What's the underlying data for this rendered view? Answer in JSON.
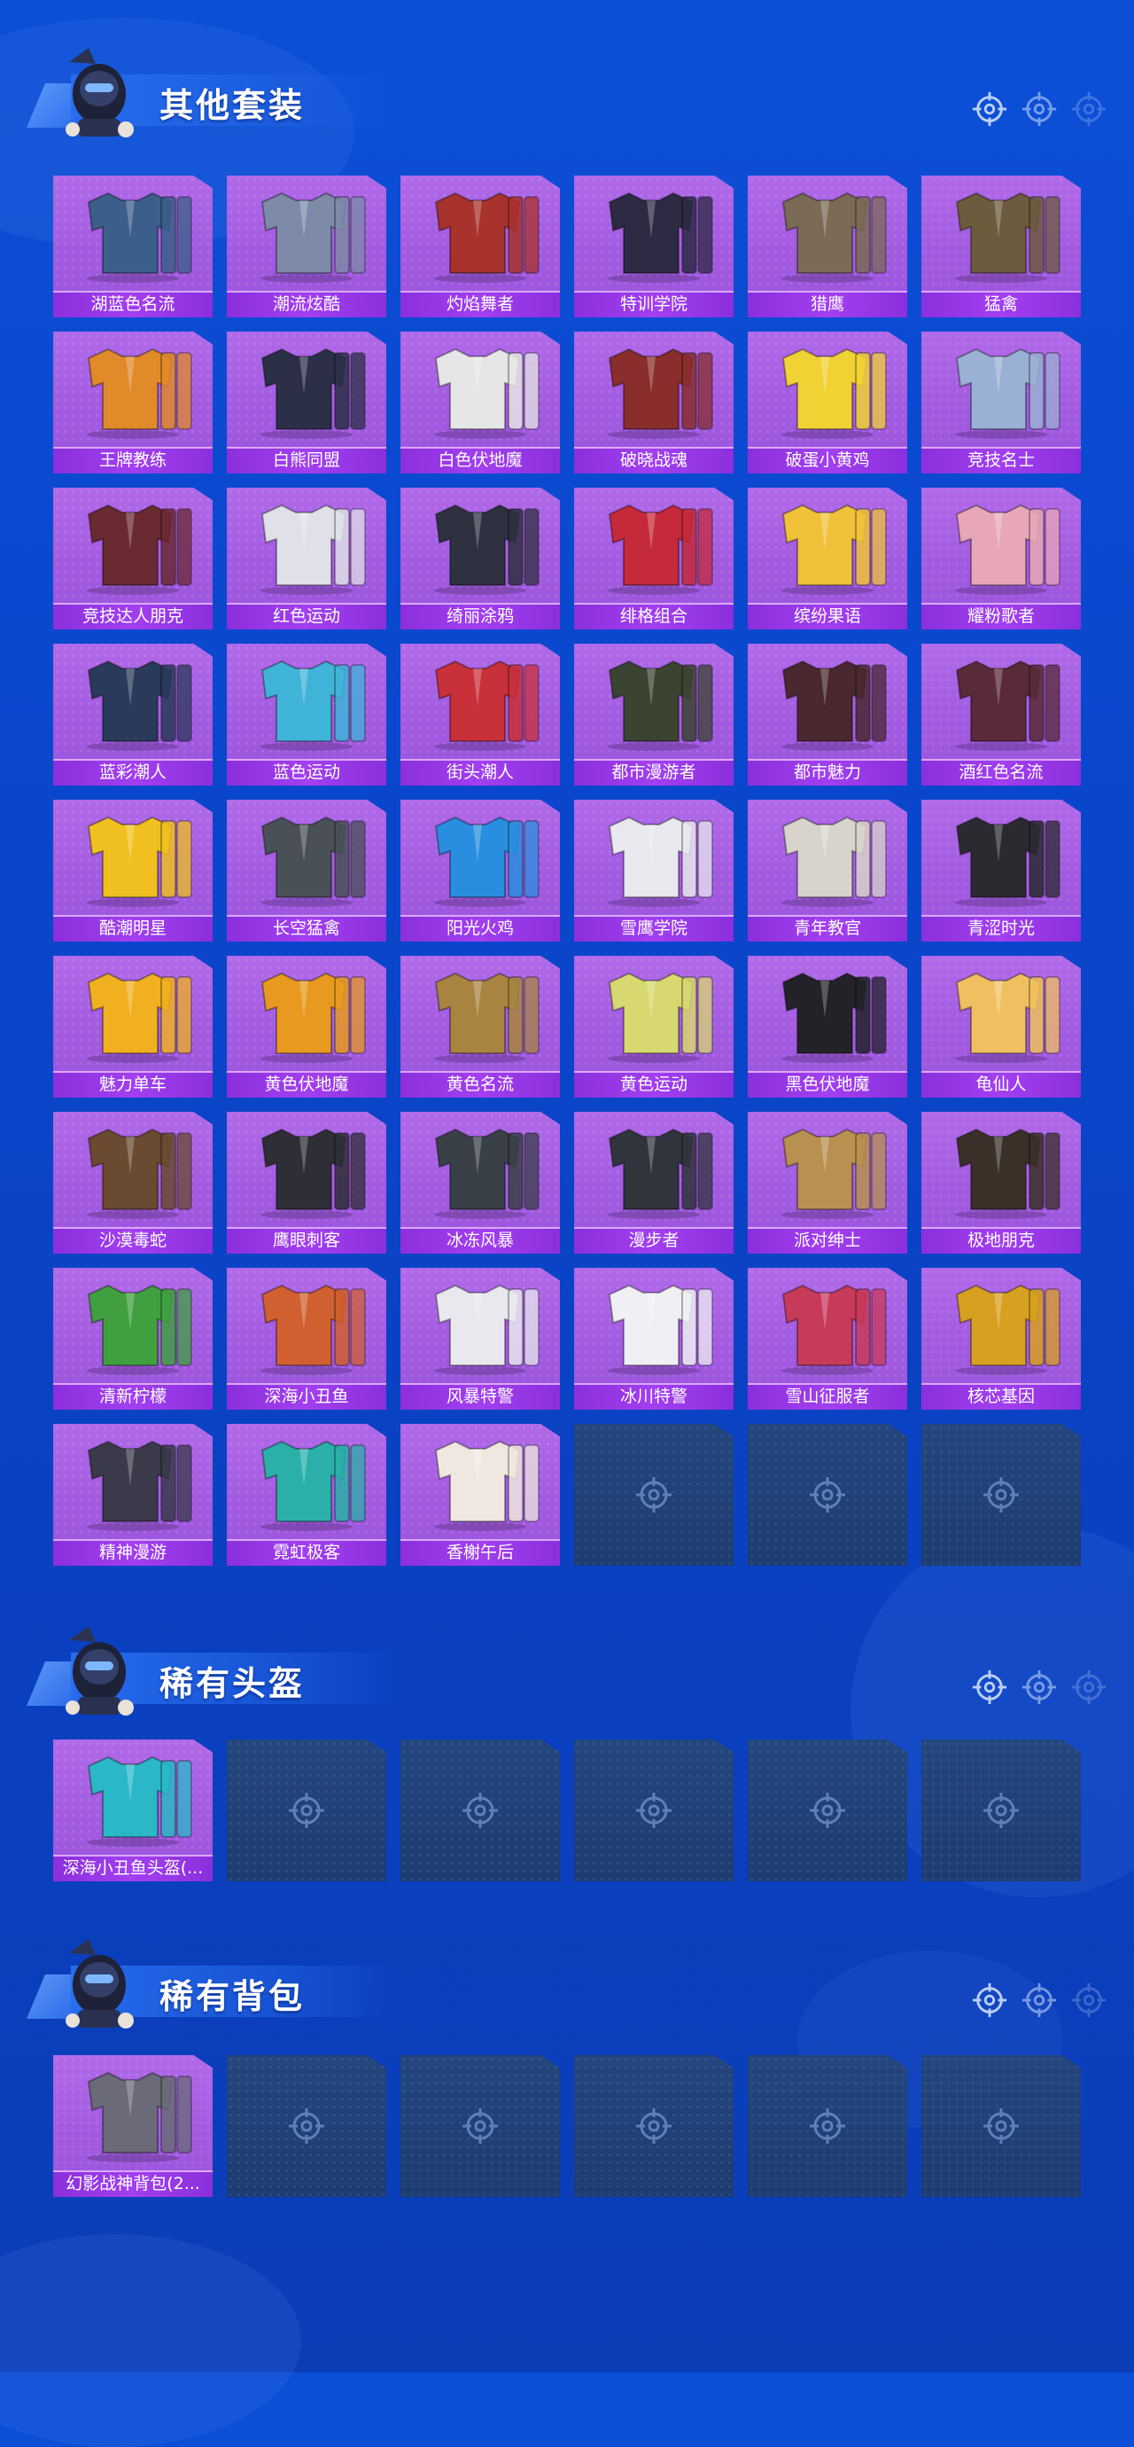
{
  "sections": [
    {
      "title": "其他套装",
      "items": [
        {
          "label": "湖蓝色名流",
          "color": "#3b5f8a"
        },
        {
          "label": "潮流炫酷",
          "color": "#7d8aa8"
        },
        {
          "label": "灼焰舞者",
          "color": "#a8322c"
        },
        {
          "label": "特训学院",
          "color": "#2d2a44"
        },
        {
          "label": "猎鹰",
          "color": "#7b6a55"
        },
        {
          "label": "猛禽",
          "color": "#6d5b3e"
        },
        {
          "label": "王牌教练",
          "color": "#e08a2a"
        },
        {
          "label": "白熊同盟",
          "color": "#2c2f48"
        },
        {
          "label": "白色伏地魔",
          "color": "#e6e6e6"
        },
        {
          "label": "破晓战魂",
          "color": "#8a2d2d"
        },
        {
          "label": "破蛋小黄鸡",
          "color": "#f1d234"
        },
        {
          "label": "竞技名士",
          "color": "#9ab0d4"
        },
        {
          "label": "竞技达人朋克",
          "color": "#6a2a32"
        },
        {
          "label": "红色运动",
          "color": "#e0e0e8"
        },
        {
          "label": "绮丽涂鸦",
          "color": "#2e3140"
        },
        {
          "label": "绯格组合",
          "color": "#c42a3a"
        },
        {
          "label": "缤纷果语",
          "color": "#f0c23a"
        },
        {
          "label": "耀粉歌者",
          "color": "#e8a7b8"
        },
        {
          "label": "蓝彩潮人",
          "color": "#2a3a5a"
        },
        {
          "label": "蓝色运动",
          "color": "#3fb4d8"
        },
        {
          "label": "街头潮人",
          "color": "#c8303a"
        },
        {
          "label": "都市漫游者",
          "color": "#3a4430"
        },
        {
          "label": "都市魅力",
          "color": "#4a2830"
        },
        {
          "label": "酒红色名流",
          "color": "#5a2a38"
        },
        {
          "label": "酷潮明星",
          "color": "#f0c020"
        },
        {
          "label": "长空猛禽",
          "color": "#4a5058"
        },
        {
          "label": "阳光火鸡",
          "color": "#2a8ee0"
        },
        {
          "label": "雪鹰学院",
          "color": "#e8e8ee"
        },
        {
          "label": "青年教官",
          "color": "#d8d4cc"
        },
        {
          "label": "青涩时光",
          "color": "#2a2a30"
        },
        {
          "label": "魅力单车",
          "color": "#f0b020"
        },
        {
          "label": "黄色伏地魔",
          "color": "#e89a20"
        },
        {
          "label": "黄色名流",
          "color": "#a88440"
        },
        {
          "label": "黄色运动",
          "color": "#d8d870"
        },
        {
          "label": "黑色伏地魔",
          "color": "#222228"
        },
        {
          "label": "龟仙人",
          "color": "#f0c060"
        },
        {
          "label": "沙漠毒蛇",
          "color": "#6a4a30"
        },
        {
          "label": "鹰眼刺客",
          "color": "#2e2e36"
        },
        {
          "label": "冰冻风暴",
          "color": "#3a4048"
        },
        {
          "label": "漫步者",
          "color": "#30343c"
        },
        {
          "label": "派对绅士",
          "color": "#b89050"
        },
        {
          "label": "极地朋克",
          "color": "#3a3028"
        },
        {
          "label": "清新柠檬",
          "color": "#40a040"
        },
        {
          "label": "深海小丑鱼",
          "color": "#d06030"
        },
        {
          "label": "风暴特警",
          "color": "#e8e8ee"
        },
        {
          "label": "冰川特警",
          "color": "#f0f0f4"
        },
        {
          "label": "雪山征服者",
          "color": "#c83a5a"
        },
        {
          "label": "核芯基因",
          "color": "#d8a020"
        },
        {
          "label": "精神漫游",
          "color": "#3a3a4a"
        },
        {
          "label": "霓虹极客",
          "color": "#2ab0a8"
        },
        {
          "label": "香榭午后",
          "color": "#f0e8e0"
        }
      ],
      "empty_slots": 3
    },
    {
      "title": "稀有头盔",
      "items": [
        {
          "label": "深海小丑鱼头盔(...",
          "color": "#2ab8c8"
        }
      ],
      "empty_slots": 5
    },
    {
      "title": "稀有背包",
      "items": [
        {
          "label": "幻影战神背包(2...",
          "color": "#6a6a78"
        }
      ],
      "empty_slots": 5
    }
  ],
  "icons": {
    "deco": "crosshair-icon",
    "empty": "crosshair-icon",
    "mascot": "mascot-character-icon"
  },
  "colors": {
    "card_bg": "#a25be0",
    "label_bg": "#9b37ea",
    "empty_bg": "#1f3f75",
    "page_bg": "#0a46cc"
  }
}
